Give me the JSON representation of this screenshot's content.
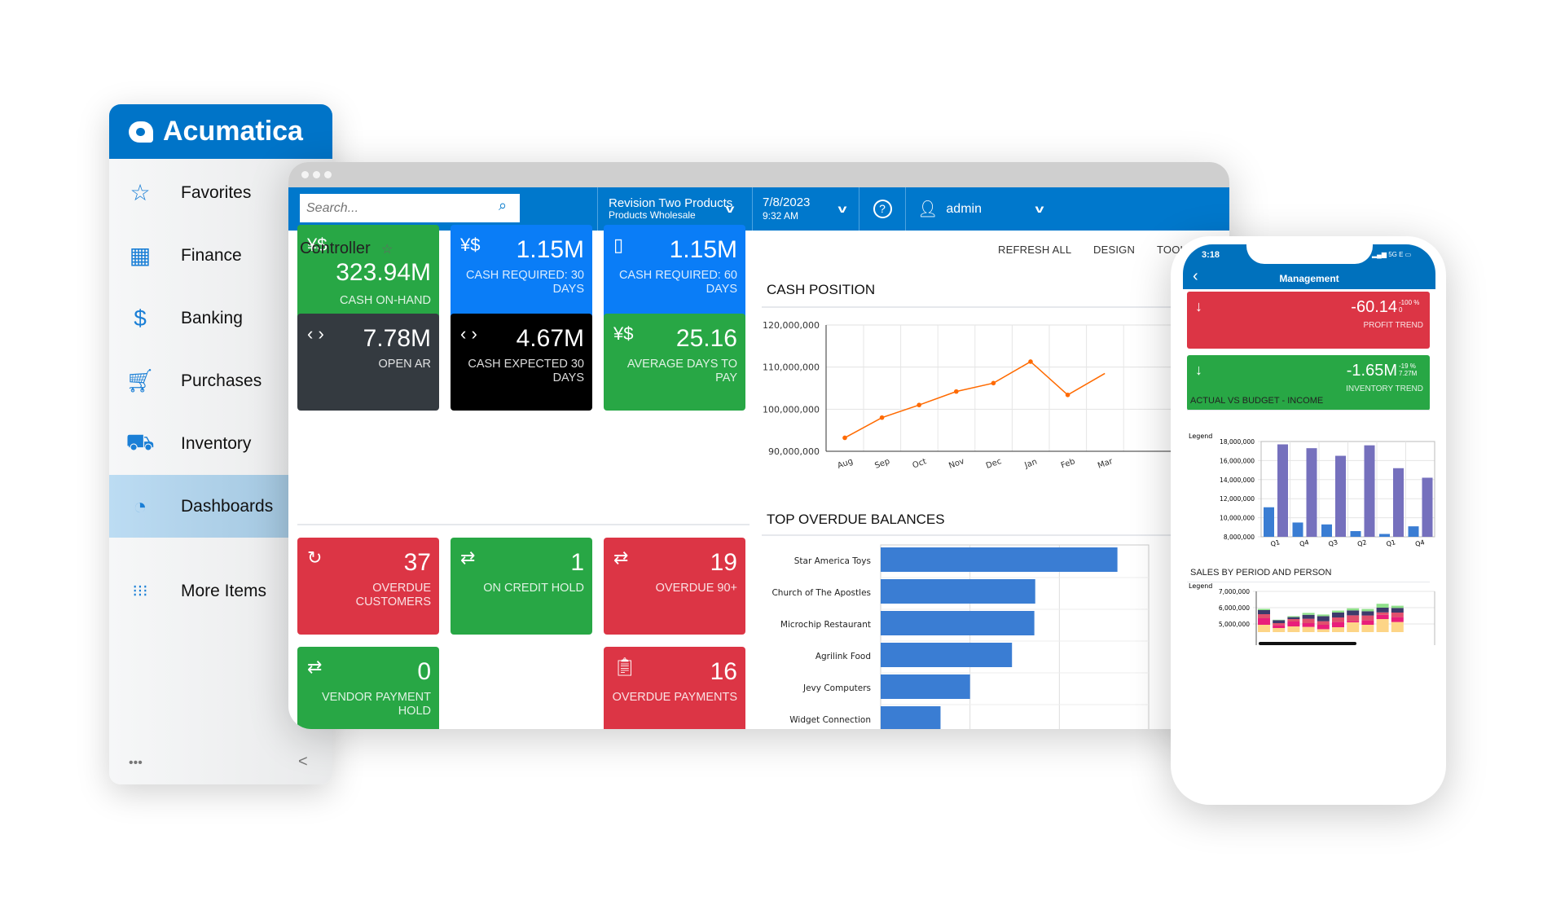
{
  "sidebar": {
    "brand": "Acumatica",
    "items": [
      {
        "label": "Favorites",
        "icon": "star-icon"
      },
      {
        "label": "Finance",
        "icon": "calculator-icon"
      },
      {
        "label": "Banking",
        "icon": "dollar-icon"
      },
      {
        "label": "Purchases",
        "icon": "cart-icon"
      },
      {
        "label": "Inventory",
        "icon": "truck-icon"
      },
      {
        "label": "Dashboards",
        "icon": "gauge-icon",
        "active": true
      },
      {
        "label": "More Items",
        "icon": "grid-dots-icon"
      }
    ],
    "more_label": "•••",
    "collapse_label": "<"
  },
  "header": {
    "search_placeholder": "Search...",
    "company": "Revision Two Products",
    "branch": "Products Wholesale",
    "date": "7/8/2023",
    "time": "9:32 AM",
    "user": "admin"
  },
  "page": {
    "title": "Controller",
    "toolbar": [
      "REFRESH ALL",
      "DESIGN",
      "TOOLS"
    ]
  },
  "tiles": [
    {
      "value": "323.94M",
      "label": "CASH ON-HAND",
      "color": "#28a745",
      "icon": "currency-icon"
    },
    {
      "value": "1.15M",
      "label": "CASH REQUIRED: 30 DAYS",
      "color": "#0a7df7",
      "icon": "currency-icon"
    },
    {
      "value": "1.15M",
      "label": "CASH REQUIRED: 60 DAYS",
      "color": "#0a7df7",
      "icon": "document-icon"
    },
    {
      "value": "7.78M",
      "label": "OPEN AR",
      "color": "#343a40",
      "icon": "code-icon"
    },
    {
      "value": "4.67M",
      "label": "CASH EXPECTED 30 DAYS",
      "color": "#000000",
      "icon": "code-icon"
    },
    {
      "value": "25.16",
      "label": "AVERAGE DAYS TO PAY",
      "color": "#28a745",
      "icon": "currency-icon"
    },
    {
      "value": "37",
      "label": "OVERDUE CUSTOMERS",
      "color": "#dc3545",
      "icon": "refresh-icon"
    },
    {
      "value": "1",
      "label": "ON CREDIT HOLD",
      "color": "#28a745",
      "icon": "transfer-icon"
    },
    {
      "value": "19",
      "label": "OVERDUE 90+",
      "color": "#dc3545",
      "icon": "transfer-icon"
    },
    {
      "value": "0",
      "label": "VENDOR PAYMENT HOLD",
      "color": "#28a745",
      "icon": "transfer-icon"
    },
    {
      "value": "16",
      "label": "OVERDUE PAYMENTS",
      "color": "#dc3545",
      "icon": "clipboard-icon"
    }
  ],
  "chart_data": [
    {
      "type": "line",
      "title": "CASH POSITION",
      "categories": [
        "Aug",
        "Sep",
        "Oct",
        "Nov",
        "Dec",
        "Jan",
        "Feb",
        "Mar"
      ],
      "values": [
        93200000,
        98000000,
        101000000,
        104200000,
        106200000,
        111300000,
        103400000,
        108500000
      ],
      "ylim": [
        90000000,
        120000000
      ],
      "yticks": [
        "120,000,000",
        "110,000,000",
        "100,000,000",
        "90,000,000"
      ],
      "color": "#ff6a00",
      "grid": true
    },
    {
      "type": "bar",
      "orientation": "horizontal",
      "title": "TOP OVERDUE BALANCES",
      "categories": [
        "Star America Toys",
        "Church of The Apostles",
        "Microchip Restaurant",
        "Agrilink Food",
        "Jevy Computers",
        "Widget Connection"
      ],
      "values": [
        2.65,
        1.73,
        1.72,
        1.47,
        1.0,
        0.67
      ],
      "xlim": [
        0,
        3
      ],
      "color": "#3a7dd3",
      "grid": true
    },
    {
      "type": "bar",
      "title": "ACTUAL VS BUDGET - INCOME",
      "legend_label": "Legend",
      "categories": [
        "Q1",
        "Q4",
        "Q3",
        "Q2",
        "Q1",
        "Q4"
      ],
      "series": [
        {
          "values": [
            11100000,
            9500000,
            9300000,
            8600000,
            8300000,
            9100000
          ],
          "color": "#3a7dd3"
        },
        {
          "values": [
            17700000,
            17300000,
            16500000,
            17600000,
            15200000,
            14200000
          ],
          "color": "#7570bd"
        }
      ],
      "ylim": [
        8000000,
        18000000
      ],
      "yticks": [
        "18,000,000",
        "16,000,000",
        "14,000,000",
        "12,000,000",
        "10,000,000",
        "8,000,000"
      ]
    },
    {
      "type": "bar",
      "stacked": true,
      "title": "SALES BY PERIOD AND PERSON",
      "legend_label": "Legend",
      "yticks": [
        "7,000,000",
        "6,000,000",
        "5,000,000"
      ],
      "ylim": [
        4600000,
        7000000
      ],
      "colors": [
        "#fdd587",
        "#e91e7a",
        "#e0506d",
        "#3d3a6b",
        "#8fe08a"
      ],
      "series_stacks": [
        [
          4950000,
          5350000,
          5600000,
          5850000,
          5930000
        ],
        [
          4750000,
          4920000,
          5050000,
          5230000,
          5260000
        ],
        [
          4850000,
          5150000,
          5300000,
          5420000,
          5480000
        ],
        [
          4820000,
          5050000,
          5320000,
          5560000,
          5680000
        ],
        [
          4680000,
          4950000,
          5170000,
          5480000,
          5580000
        ],
        [
          4800000,
          5120000,
          5400000,
          5700000,
          5820000
        ],
        [
          5100000,
          5180000,
          5530000,
          5830000,
          5960000
        ],
        [
          4950000,
          5220000,
          5520000,
          5780000,
          5920000
        ],
        [
          5300000,
          5560000,
          5710000,
          6000000,
          6240000
        ],
        [
          5120000,
          5420000,
          5700000,
          5980000,
          6120000
        ]
      ]
    }
  ],
  "phone": {
    "time": "3:18",
    "status": "5G E",
    "title": "Management",
    "tiles": [
      {
        "value": "-60.14",
        "pct": "-100 %",
        "prev": "0",
        "label": "PROFIT TREND",
        "color": "#dc3545",
        "icon": "arrow-down-icon"
      },
      {
        "value": "-1.65M",
        "pct": "-19 %",
        "prev": "7.27M",
        "label": "INVENTORY TREND",
        "color": "#28a745",
        "icon": "arrow-down-icon"
      }
    ]
  }
}
